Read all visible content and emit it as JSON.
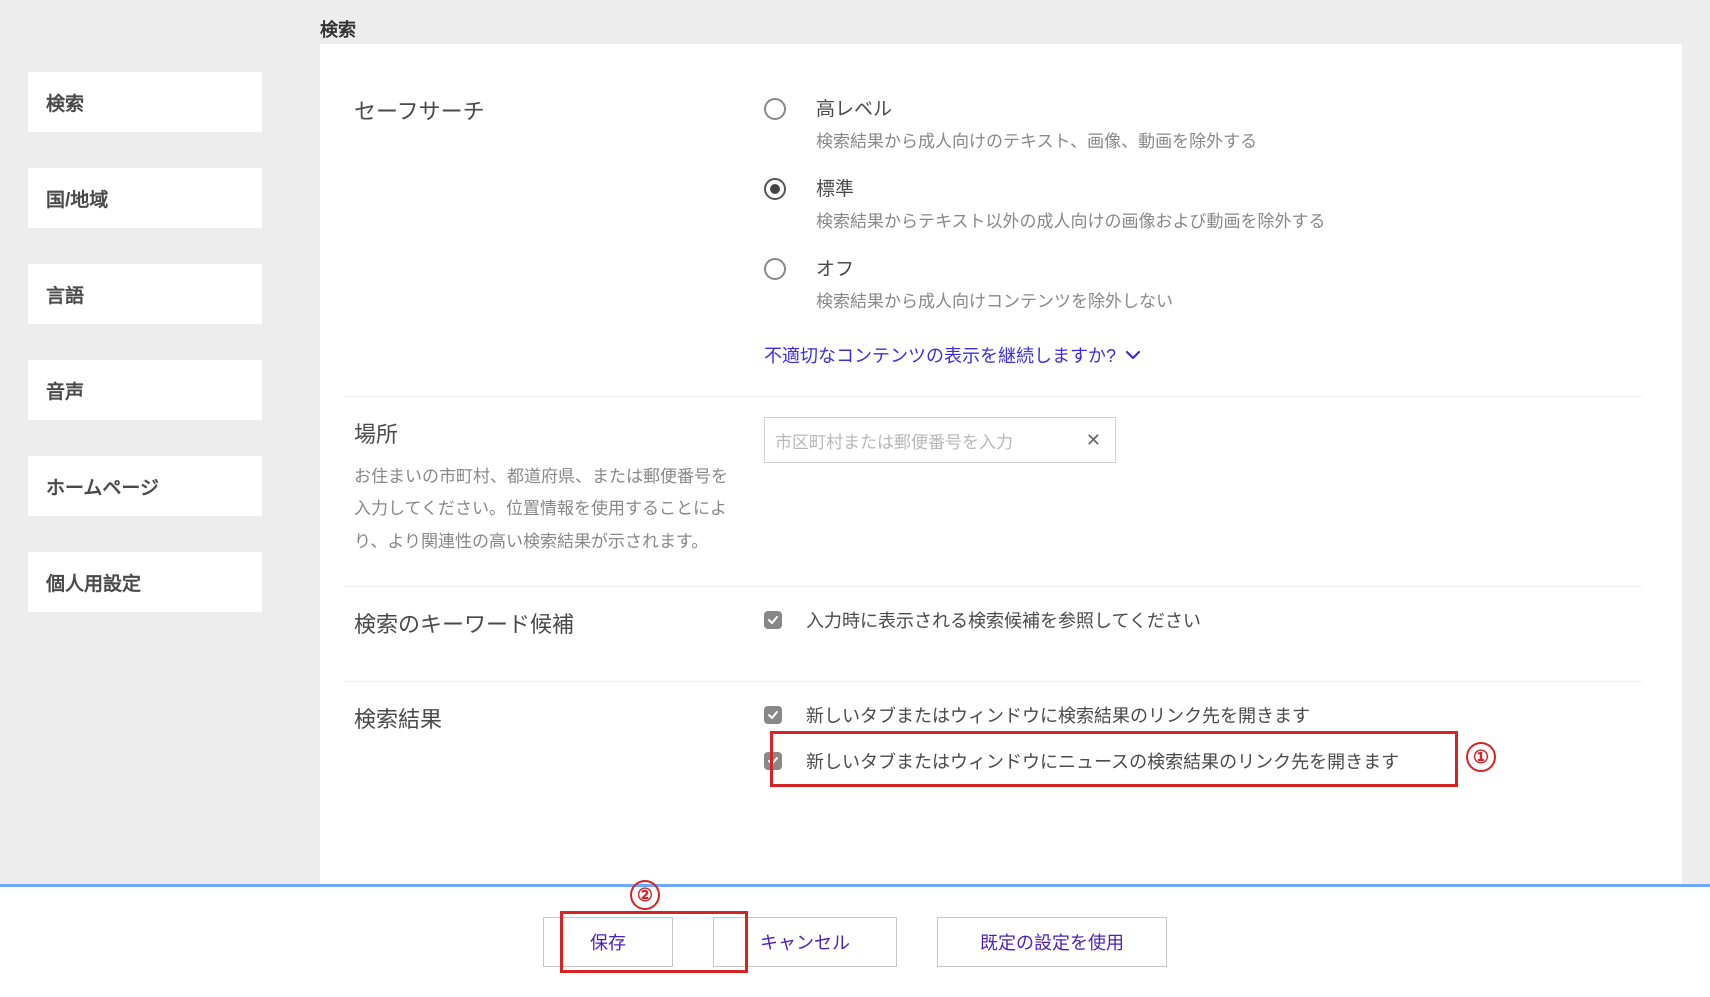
{
  "page_title": "検索",
  "sidebar": {
    "items": [
      {
        "label": "検索"
      },
      {
        "label": "国/地域"
      },
      {
        "label": "言語"
      },
      {
        "label": "音声"
      },
      {
        "label": "ホームページ"
      },
      {
        "label": "個人用設定"
      }
    ]
  },
  "safesearch": {
    "heading": "セーフサーチ",
    "options": [
      {
        "label": "高レベル",
        "desc": "検索結果から成人向けのテキスト、画像、動画を除外する",
        "selected": false
      },
      {
        "label": "標準",
        "desc": "検索結果からテキスト以外の成人向けの画像および動画を除外する",
        "selected": true
      },
      {
        "label": "オフ",
        "desc": "検索結果から成人向けコンテンツを除外しない",
        "selected": false
      }
    ],
    "expand_link": "不適切なコンテンツの表示を継続しますか?"
  },
  "location": {
    "heading": "場所",
    "desc": "お住まいの市町村、都道府県、または郵便番号を入力してください。位置情報を使用することにより、より関連性の高い検索結果が示されます。",
    "placeholder": "市区町村または郵便番号を入力"
  },
  "suggestions": {
    "heading": "検索のキーワード候補",
    "option_label": "入力時に表示される検索候補を参照してください",
    "checked": true
  },
  "results": {
    "heading": "検索結果",
    "options": [
      {
        "label": "新しいタブまたはウィンドウに検索結果のリンク先を開きます",
        "checked": true
      },
      {
        "label": "新しいタブまたはウィンドウにニュースの検索結果のリンク先を開きます",
        "checked": true
      }
    ]
  },
  "footer": {
    "save": "保存",
    "cancel": "キャンセル",
    "defaults": "既定の設定を使用"
  },
  "annotations": {
    "n1": "①",
    "n2": "②"
  }
}
